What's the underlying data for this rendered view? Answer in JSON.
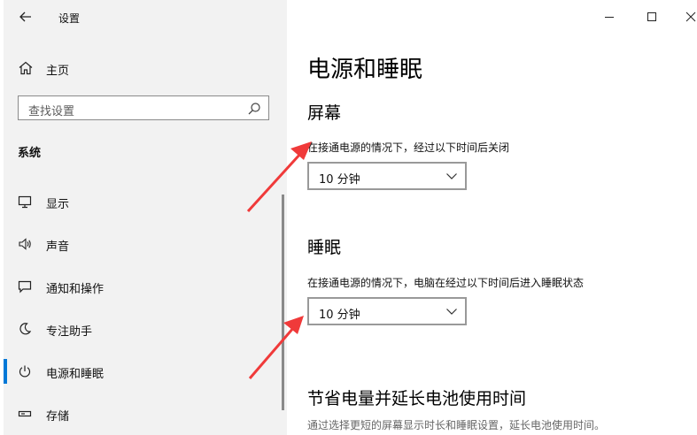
{
  "window": {
    "back_icon": "arrow-left-icon",
    "title": "设置",
    "controls": [
      "minimize-icon",
      "maximize-icon",
      "close-icon"
    ]
  },
  "sidebar": {
    "home": {
      "label": "主页",
      "icon": "home-icon"
    },
    "search": {
      "placeholder": "查找设置",
      "icon": "search-icon"
    },
    "section": "系统",
    "items": [
      {
        "label": "显示",
        "icon": "monitor-icon",
        "active": false
      },
      {
        "label": "声音",
        "icon": "speaker-icon",
        "active": false
      },
      {
        "label": "通知和操作",
        "icon": "message-icon",
        "active": false
      },
      {
        "label": "专注助手",
        "icon": "moon-icon",
        "active": false
      },
      {
        "label": "电源和睡眠",
        "icon": "power-icon",
        "active": true
      },
      {
        "label": "存储",
        "icon": "storage-icon",
        "active": false
      }
    ],
    "accent_color": "#0078d7"
  },
  "main": {
    "title": "电源和睡眠",
    "screen": {
      "heading": "屏幕",
      "description": "在接通电源的情况下，经过以下时间后关闭",
      "value": "10 分钟"
    },
    "sleep": {
      "heading": "睡眠",
      "description": "在接通电源的情况下，电脑在经过以下时间后进入睡眠状态",
      "value": "10 分钟"
    },
    "battery": {
      "heading": "节省电量并延长电池使用时间",
      "description": "通过选择更短的屏幕显示时长和睡眠设置，延长电池使用时间。"
    }
  },
  "annotation_color": "#f03a3a"
}
